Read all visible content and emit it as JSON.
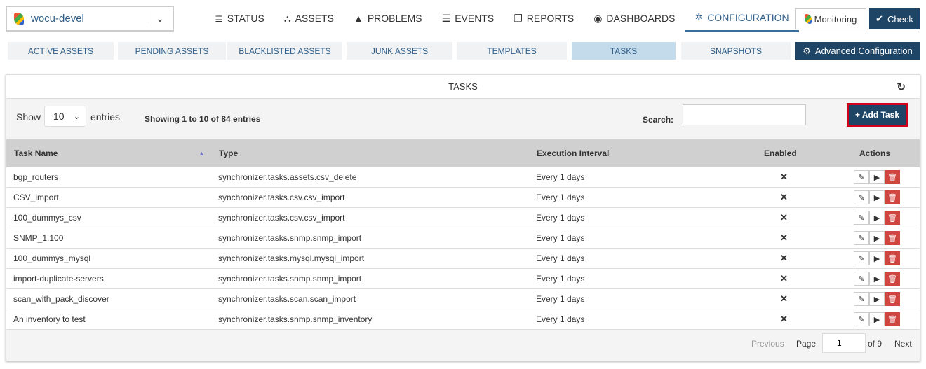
{
  "header": {
    "site": "wocu-devel",
    "nav": [
      {
        "label": "STATUS",
        "icon": "list-icon",
        "glyph": "≣"
      },
      {
        "label": "ASSETS",
        "icon": "cubes-icon",
        "glyph": "⛬"
      },
      {
        "label": "PROBLEMS",
        "icon": "warning-icon",
        "glyph": "▲"
      },
      {
        "label": "EVENTS",
        "icon": "database-icon",
        "glyph": "☰"
      },
      {
        "label": "REPORTS",
        "icon": "copy-icon",
        "glyph": "❐"
      },
      {
        "label": "DASHBOARDS",
        "icon": "dashboard-icon",
        "glyph": "◉"
      },
      {
        "label": "CONFIGURATION",
        "icon": "cog-icon",
        "glyph": "✲",
        "active": true
      }
    ],
    "monitoring": "Monitoring",
    "check": "Check"
  },
  "subtabs": [
    {
      "label": "ACTIVE ASSETS"
    },
    {
      "label": "PENDING ASSETS"
    },
    {
      "label": "BLACKLISTED ASSETS"
    },
    {
      "label": "JUNK ASSETS"
    },
    {
      "label": "TEMPLATES"
    },
    {
      "label": "TASKS",
      "active": true
    },
    {
      "label": "SNAPSHOTS"
    }
  ],
  "advanced": "Advanced Configuration",
  "panel": {
    "title": "TASKS",
    "show": "Show",
    "entries_value": "10",
    "entries": "entries",
    "info": "Showing 1 to 10 of 84 entries",
    "search_label": "Search:",
    "search_value": "",
    "add_task": "+ Add Task",
    "columns": [
      "Task Name",
      "Type",
      "Execution Interval",
      "Enabled",
      "Actions"
    ],
    "rows": [
      {
        "name": "bgp_routers",
        "type": "synchronizer.tasks.assets.csv_delete",
        "interval": "Every 1 days",
        "enabled": "✕"
      },
      {
        "name": "CSV_import",
        "type": "synchronizer.tasks.csv.csv_import",
        "interval": "Every 1 days",
        "enabled": "✕"
      },
      {
        "name": "100_dummys_csv",
        "type": "synchronizer.tasks.csv.csv_import",
        "interval": "Every 1 days",
        "enabled": "✕"
      },
      {
        "name": "SNMP_1.100",
        "type": "synchronizer.tasks.snmp.snmp_import",
        "interval": "Every 1 days",
        "enabled": "✕"
      },
      {
        "name": "100_dummys_mysql",
        "type": "synchronizer.tasks.mysql.mysql_import",
        "interval": "Every 1 days",
        "enabled": "✕"
      },
      {
        "name": "import-duplicate-servers",
        "type": "synchronizer.tasks.snmp.snmp_import",
        "interval": "Every 1 days",
        "enabled": "✕"
      },
      {
        "name": "scan_with_pack_discover",
        "type": "synchronizer.tasks.scan.scan_import",
        "interval": "Every 1 days",
        "enabled": "✕"
      },
      {
        "name": "An inventory to test",
        "type": "synchronizer.tasks.snmp.snmp_inventory",
        "interval": "Every 1 days",
        "enabled": "✕"
      }
    ],
    "pagination": {
      "previous": "Previous",
      "page": "Page",
      "page_value": "1",
      "of": "of 9",
      "next": "Next"
    }
  },
  "colors": {
    "primary": "#1f4566",
    "accent": "#2f5f8a",
    "danger": "#d0453f",
    "highlight": "#d0021b"
  }
}
